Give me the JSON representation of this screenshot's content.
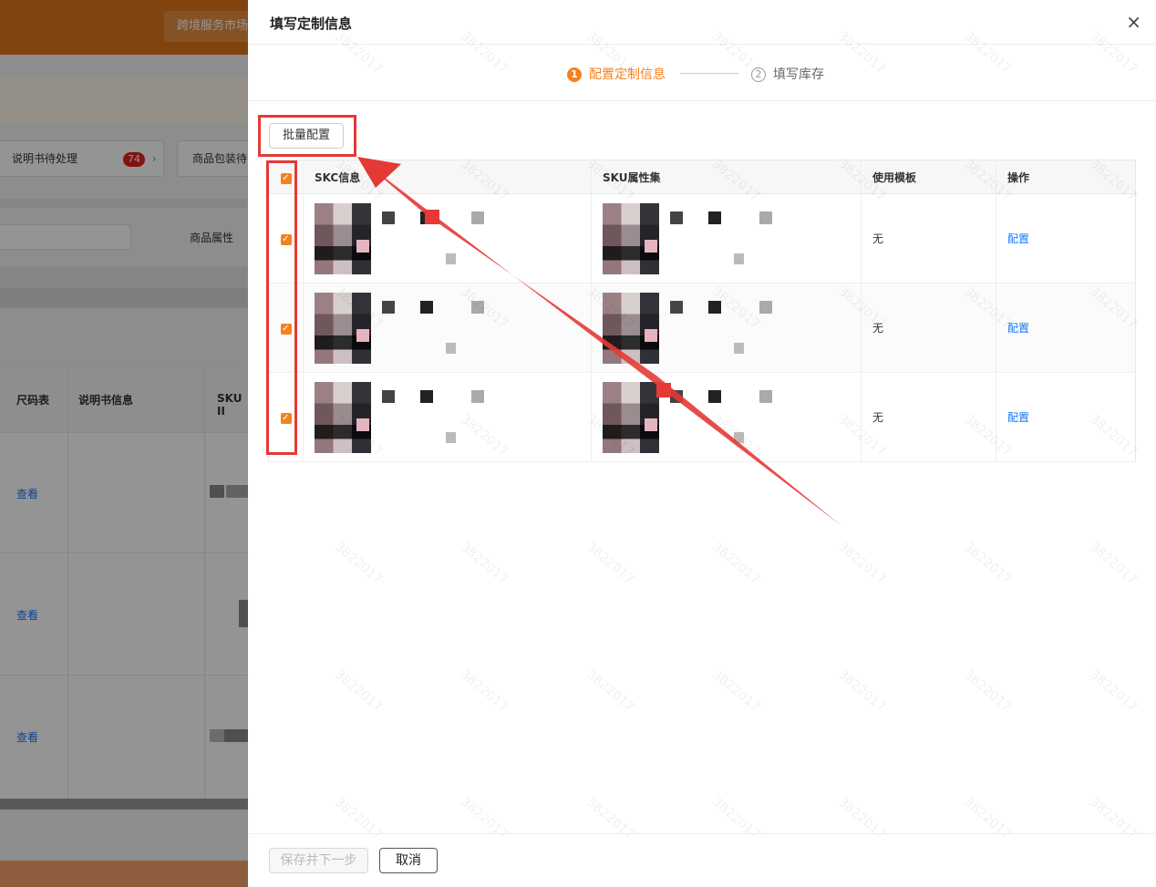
{
  "background": {
    "market_label": "跨境服务市场",
    "manual_card_label": "说明书待处理",
    "manual_badge": "74",
    "package_card_label": "商品包装待",
    "attr_label": "商品属性",
    "table_headers": [
      "尺码表",
      "说明书信息",
      "SKU II"
    ],
    "row_link": "查看"
  },
  "drawer": {
    "title": "填写定制信息",
    "close_icon": "×",
    "steps": [
      {
        "num": "1",
        "label": "配置定制信息",
        "state": "active"
      },
      {
        "num": "2",
        "label": "填写库存",
        "state": "pending"
      }
    ],
    "batch_button": "批量配置",
    "table": {
      "headers": [
        "SKC信息",
        "SKU属性集",
        "使用模板",
        "操作"
      ],
      "rows": [
        {
          "template": "无",
          "action": "配置",
          "checked": true
        },
        {
          "template": "无",
          "action": "配置",
          "checked": true
        },
        {
          "template": "无",
          "action": "配置",
          "checked": true
        }
      ]
    },
    "footer": {
      "save_next": "保存并下一步",
      "cancel": "取消"
    },
    "watermark": "3822017"
  },
  "colors": {
    "accent": "#f5811f",
    "link": "#1677ff",
    "annotation": "#e53935"
  }
}
